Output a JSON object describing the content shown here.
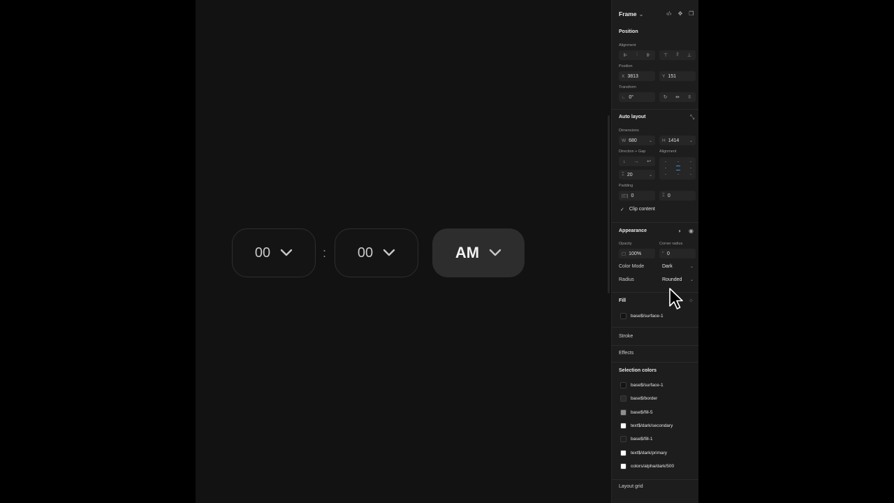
{
  "time_picker": {
    "hour": "00",
    "separator": ":",
    "minute": "00",
    "period": "AM"
  },
  "panel": {
    "title": "Frame",
    "caret": "⌄",
    "header_icons": [
      "code-icon",
      "component-icon",
      "layers-icon"
    ],
    "position": {
      "heading": "Position",
      "alignment_label": "Alignment",
      "position_label": "Position",
      "x_label": "X",
      "x_value": "3813",
      "y_label": "Y",
      "y_value": "151",
      "transform_label": "Transform",
      "rotation_value": "0°"
    },
    "auto_layout": {
      "heading": "Auto layout",
      "dimensions_label": "Dimensions",
      "w_label": "W",
      "w_value": "680",
      "h_label": "H",
      "h_value": "1414",
      "direction_label": "Direction + Gap",
      "alignment_label": "Alignment",
      "gap_value": "20",
      "padding_label": "Padding",
      "padding_h": "0",
      "padding_v": "0",
      "clip_label": "Clip content"
    },
    "appearance": {
      "heading": "Appearance",
      "opacity_label": "Opacity",
      "opacity_value": "100%",
      "corner_label": "Corner radius",
      "corner_value": "0",
      "color_mode_label": "Color Mode",
      "color_mode_value": "Dark",
      "radius_label": "Radius",
      "radius_value": "Rounded"
    },
    "fill": {
      "heading": "Fill",
      "value": "base$/surface-1"
    },
    "stroke_heading": "Stroke",
    "effects_heading": "Effects",
    "selection_colors": {
      "heading": "Selection colors",
      "items": [
        {
          "name": "base$/surface-1",
          "color": "#141414"
        },
        {
          "name": "base$/border",
          "color": "#2a2a2a"
        },
        {
          "name": "base$/fill-5",
          "color": "#8f8f8f"
        },
        {
          "name": "text$/dark/secondary",
          "color": "#ffffff"
        },
        {
          "name": "base$/fill-1",
          "color": "#1f1f1f"
        },
        {
          "name": "text$/dark/primary",
          "color": "#ffffff"
        },
        {
          "name": "colors/alpha/dark/500",
          "color": "#ffffff"
        }
      ]
    },
    "layout_grid_heading": "Layout grid"
  }
}
